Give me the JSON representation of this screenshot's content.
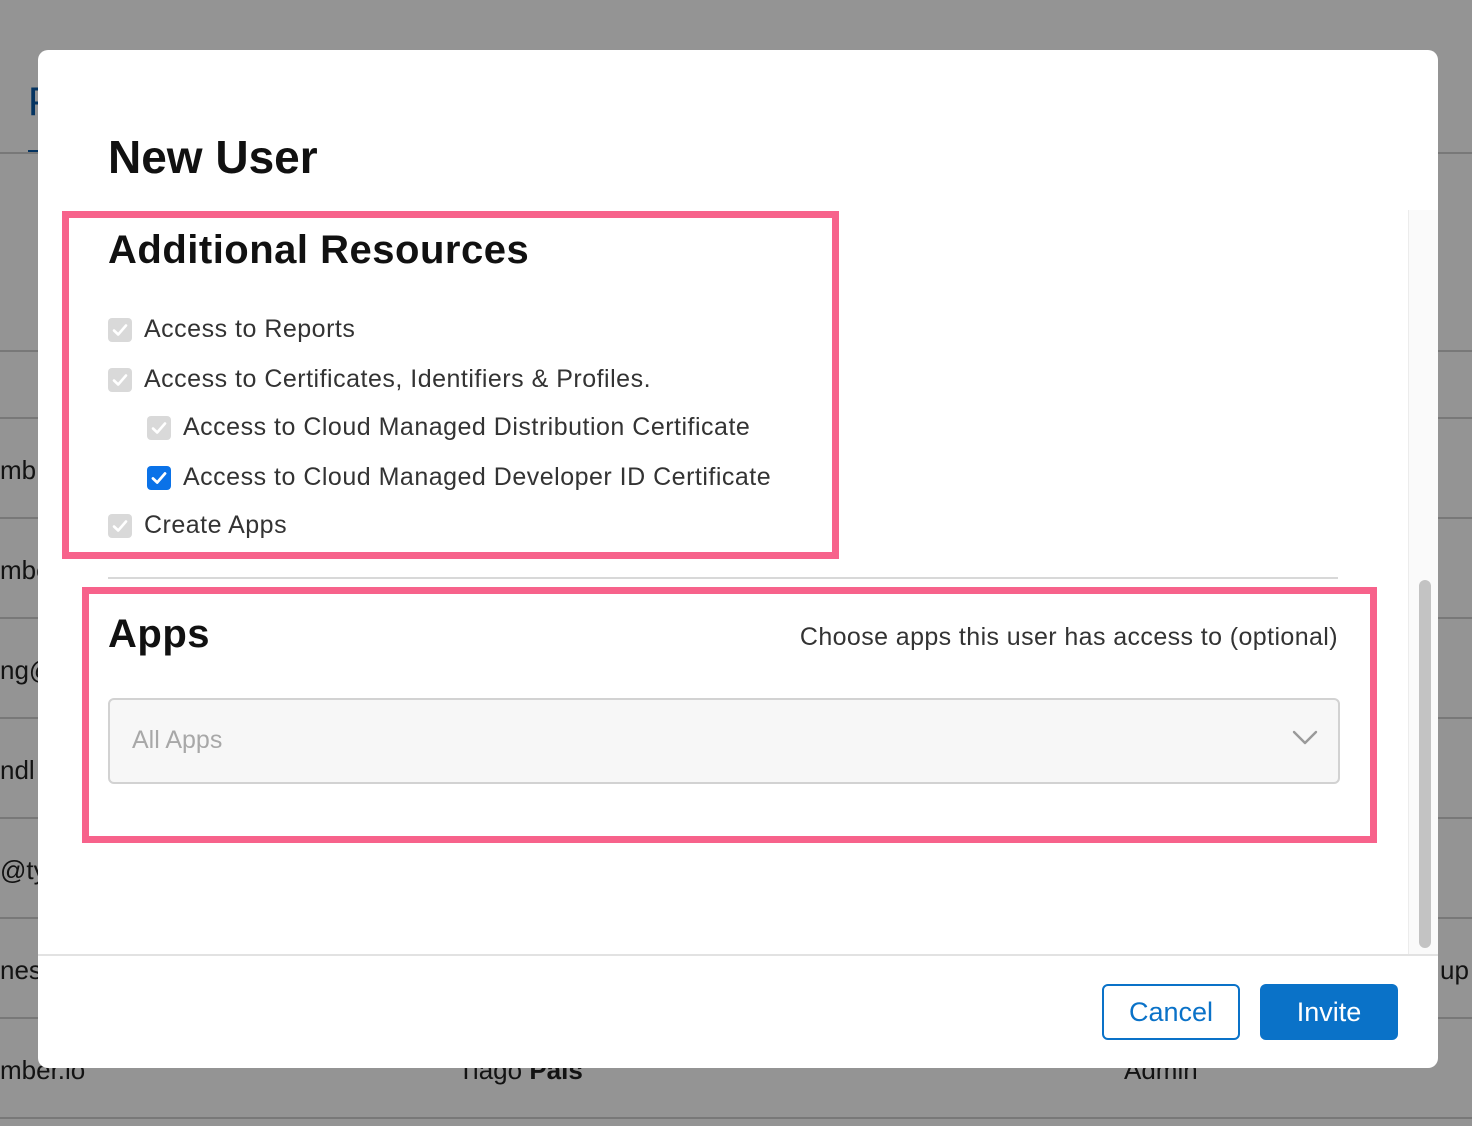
{
  "background": {
    "tab_letter": "P",
    "fragments": [
      "mb",
      "mbe",
      "ng@",
      "ndl",
      "@ty",
      "nes",
      "mber.io",
      "up"
    ],
    "partial_name_regular": "Tiago",
    "partial_name_bold": "Pais",
    "partial_role": "Admin"
  },
  "modal": {
    "title": "New User",
    "additional_resources": {
      "title": "Additional Resources",
      "items": [
        {
          "label": "Access to Reports",
          "checked": true,
          "disabled": true
        },
        {
          "label": "Access to Certificates, Identifiers & Profiles.",
          "checked": true,
          "disabled": true
        },
        {
          "label": "Access to Cloud Managed Distribution Certificate",
          "checked": true,
          "disabled": true
        },
        {
          "label": "Access to Cloud Managed Developer ID Certificate",
          "checked": true,
          "disabled": false
        },
        {
          "label": "Create Apps",
          "checked": true,
          "disabled": true
        }
      ]
    },
    "apps": {
      "title": "Apps",
      "hint": "Choose apps this user has access to (optional)",
      "select_value": "All Apps"
    },
    "buttons": {
      "cancel": "Cancel",
      "invite": "Invite"
    }
  },
  "colors": {
    "primary": "#0a72c8",
    "checkbox_active": "#0a72e8",
    "highlight": "#f7628b"
  },
  "icons": {
    "checkmark": "check-icon",
    "dropdown": "chevron-down-icon"
  }
}
